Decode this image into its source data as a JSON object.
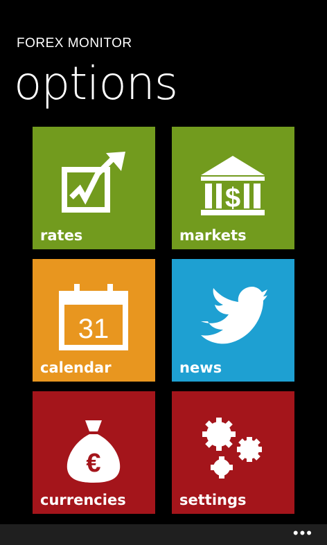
{
  "header": {
    "app_title": "FOREX MONITOR",
    "page_title": "options"
  },
  "tiles": [
    {
      "label": "rates",
      "color": "#729b1e",
      "icon": "chart-up-icon"
    },
    {
      "label": "markets",
      "color": "#729b1e",
      "icon": "bank-icon"
    },
    {
      "label": "calendar",
      "color": "#e8961f",
      "icon": "calendar-icon",
      "icon_text": "31"
    },
    {
      "label": "news",
      "color": "#1ea0d2",
      "icon": "twitter-bird-icon"
    },
    {
      "label": "currencies",
      "color": "#a4151b",
      "icon": "money-bag-icon",
      "icon_text": "€"
    },
    {
      "label": "settings",
      "color": "#a4151b",
      "icon": "gears-icon"
    }
  ],
  "app_bar": {
    "more_label": "•••",
    "color": "#1f1f1f"
  }
}
